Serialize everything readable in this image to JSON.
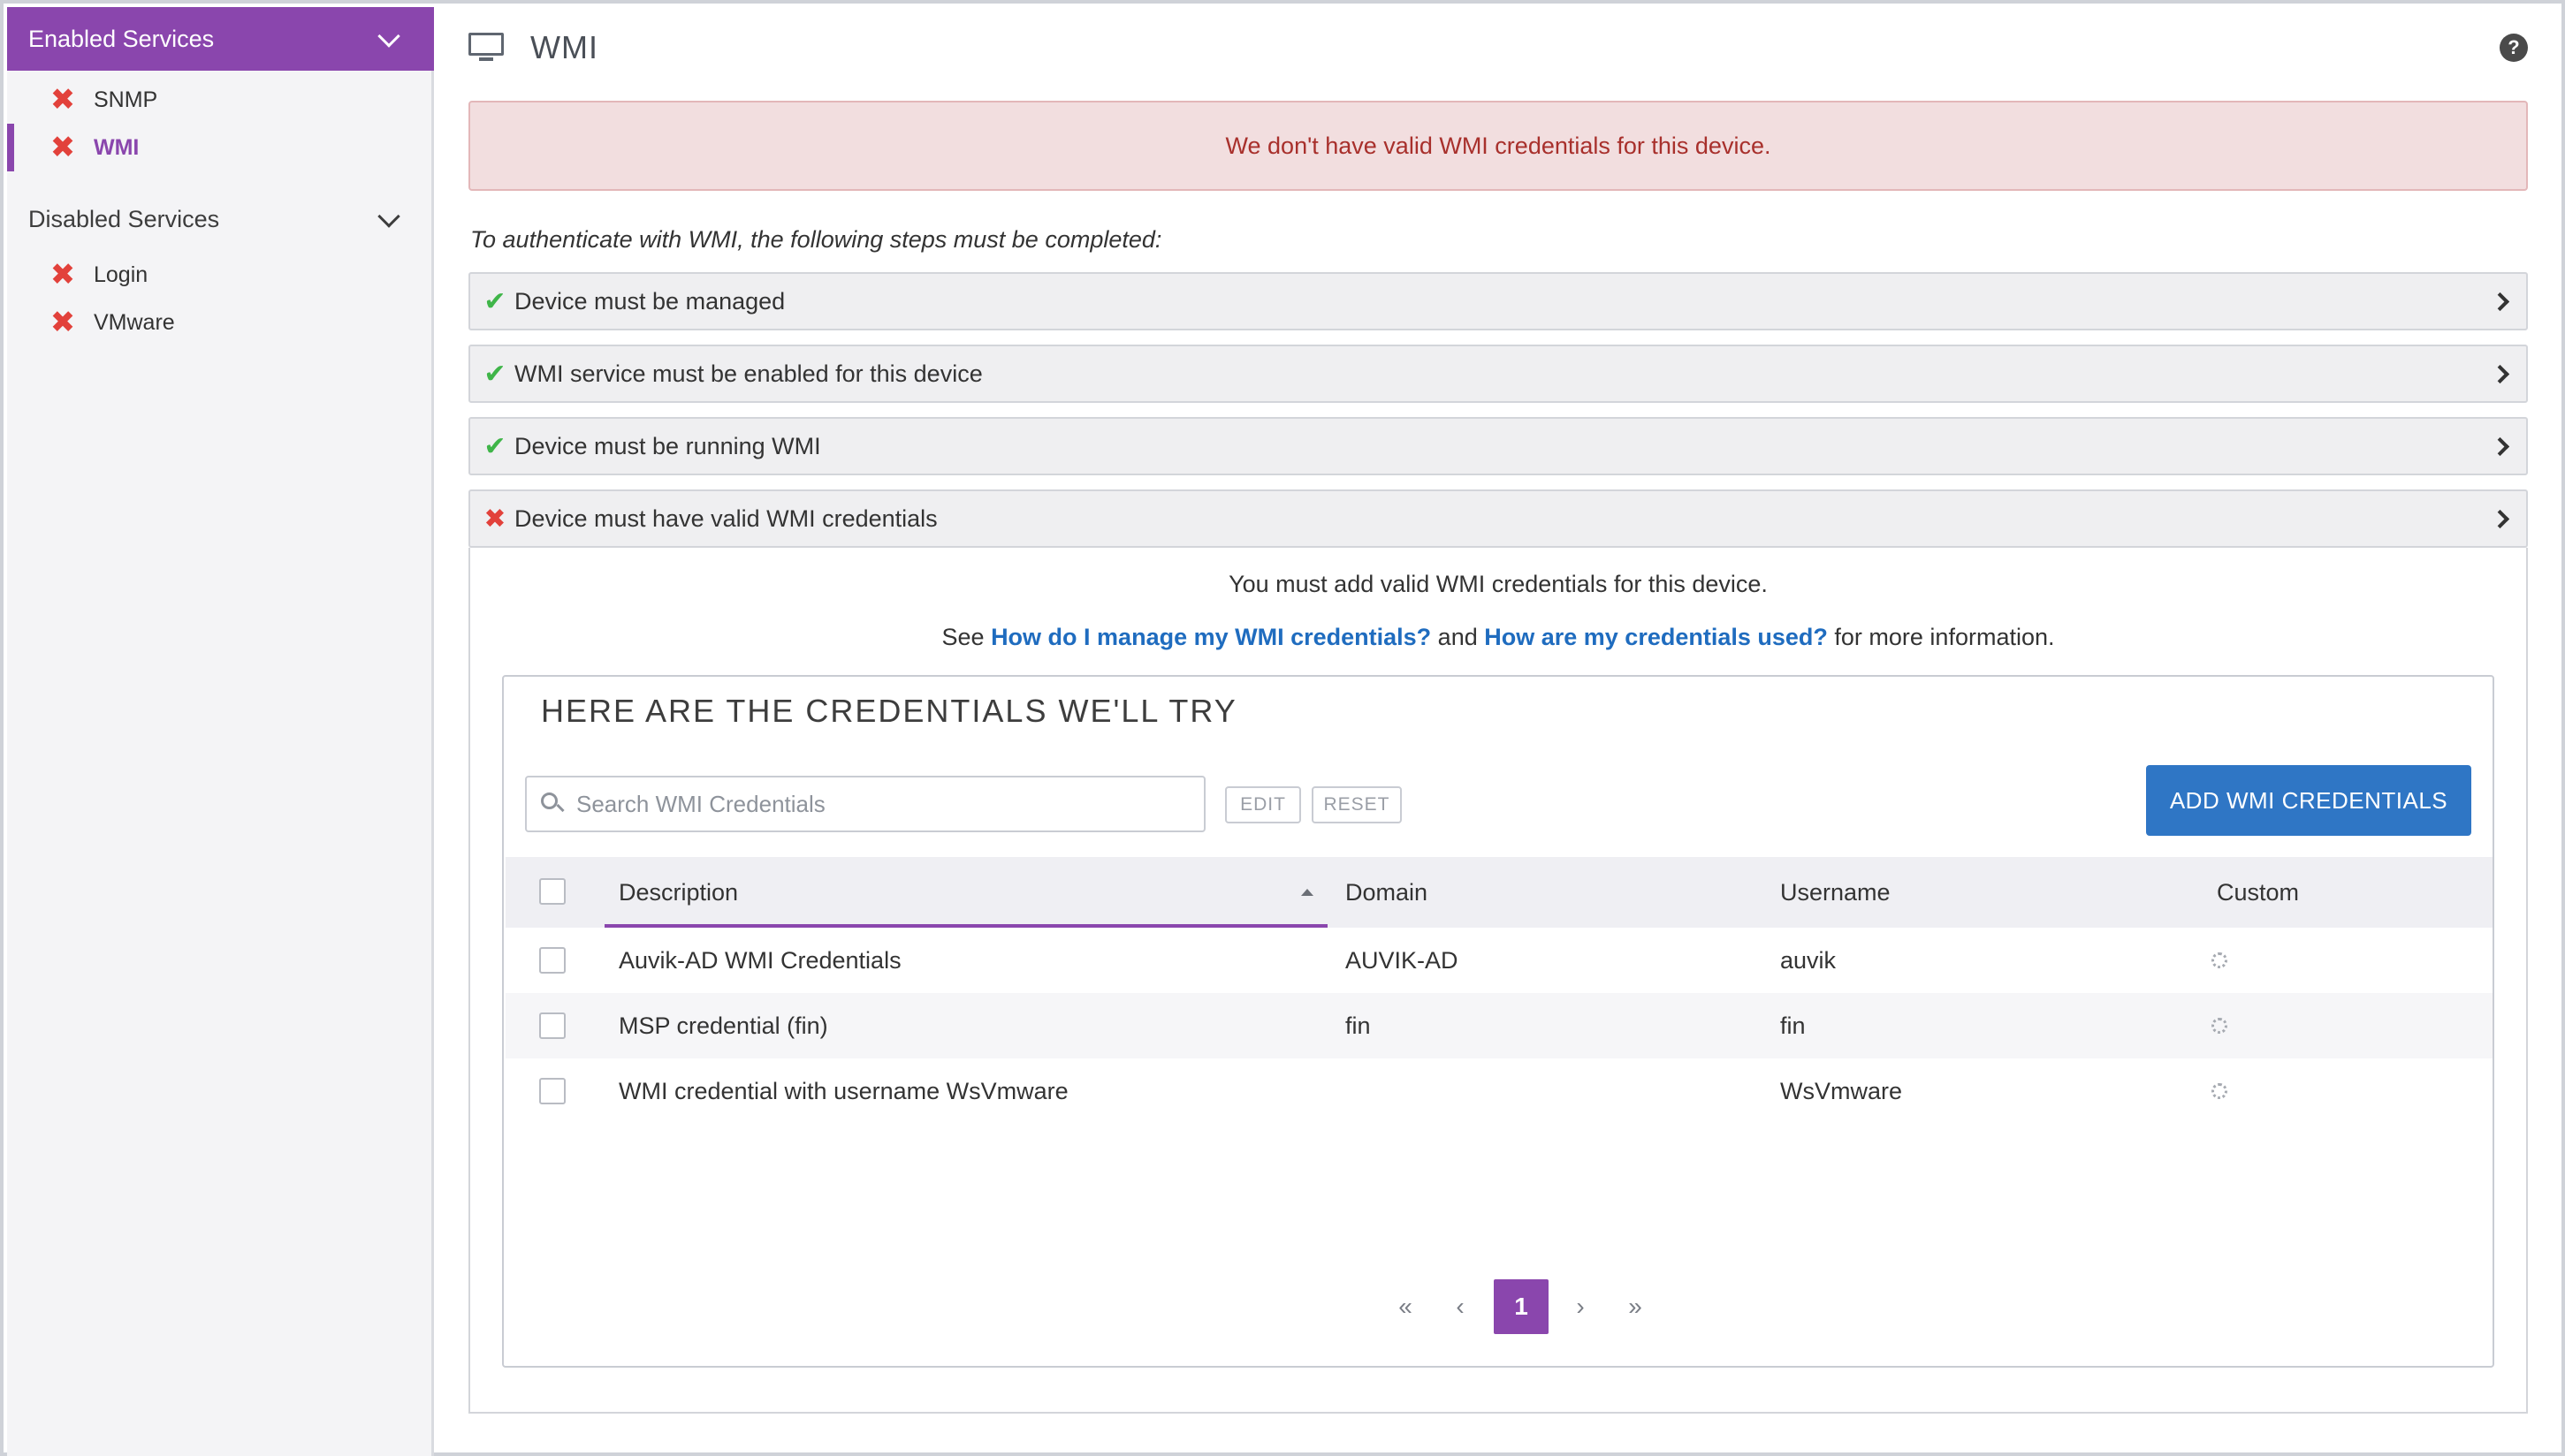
{
  "sidebar": {
    "enabled_header": "Enabled Services",
    "enabled_items": [
      {
        "label": "SNMP",
        "status": "error"
      },
      {
        "label": "WMI",
        "status": "error",
        "active": true
      }
    ],
    "disabled_header": "Disabled Services",
    "disabled_items": [
      {
        "label": "Login",
        "status": "error"
      },
      {
        "label": "VMware",
        "status": "error"
      }
    ]
  },
  "main": {
    "title": "WMI",
    "alert": "We don't have valid WMI credentials for this device.",
    "intro": "To authenticate with WMI, the following steps must be completed:",
    "steps": [
      {
        "label": "Device must be managed",
        "status": "ok"
      },
      {
        "label": "WMI service must be enabled for this device",
        "status": "ok"
      },
      {
        "label": "Device must be running WMI",
        "status": "ok"
      },
      {
        "label": "Device must have valid WMI credentials",
        "status": "error"
      }
    ],
    "step_body": {
      "line1": "You must add valid WMI credentials for this device.",
      "line2_prefix": "See",
      "link1": "How do I manage my WMI credentials?",
      "line2_mid": "and",
      "link2": "How are my credentials used?",
      "line2_suffix": "for more information."
    },
    "credentials": {
      "title": "HERE ARE THE CREDENTIALS WE'LL TRY",
      "search_placeholder": "Search WMI Credentials",
      "edit_label": "EDIT",
      "reset_label": "RESET",
      "add_label": "ADD WMI CREDENTIALS",
      "columns": [
        "Description",
        "Domain",
        "Username",
        "Custom"
      ],
      "rows": [
        {
          "description": "Auvik-AD WMI Credentials",
          "domain": "AUVIK-AD",
          "username": "auvik"
        },
        {
          "description": "MSP credential (fin)",
          "domain": "fin",
          "username": "fin"
        },
        {
          "description": "WMI credential with username WsVmware",
          "domain": "",
          "username": "WsVmware"
        }
      ],
      "pager": {
        "first": "«",
        "prev": "‹",
        "current": "1",
        "next": "›",
        "last": "»"
      }
    }
  },
  "colors": {
    "accent": "#8a46ad",
    "primary_button": "#2f76c5",
    "error": "#e2413b",
    "success": "#3fb549",
    "alert_bg": "#f2dedf",
    "alert_text": "#a8302c",
    "link": "#1f6cbf"
  },
  "icons": {
    "title_icon": "monitor-icon",
    "help": "help-icon",
    "status_error": "x-mark-icon",
    "status_ok": "check-icon",
    "row_custom": "gear-icon"
  }
}
